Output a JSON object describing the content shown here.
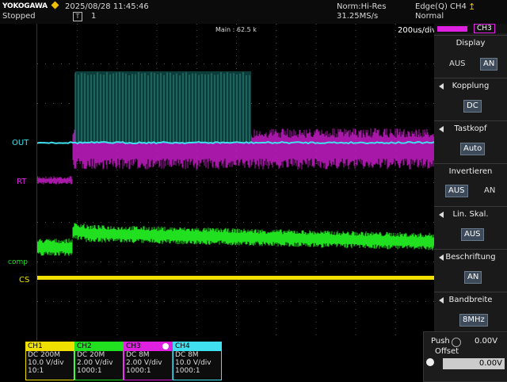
{
  "header": {
    "brand": "YOKOGAWA",
    "status": "Stopped",
    "datetime": "2025/08/28 11:45:46",
    "trigger_marker": "1",
    "acq_mode": "Norm:Hi-Res",
    "sample_rate": "31.25MS/s",
    "trigger_info": "Edge(Q) CH4",
    "trigger_mode": "Normal"
  },
  "screen": {
    "main_label": "Main : 62.5 k",
    "timebase": "200us/div",
    "labels": {
      "out": "OUT",
      "rt": "RT",
      "comp": "comp",
      "cs": "CS"
    }
  },
  "menu": {
    "channel_tab": "CH3",
    "display": {
      "title": "Display",
      "off": "AUS",
      "on": "AN"
    },
    "kopplung": {
      "title": "Kopplung",
      "value": "DC"
    },
    "tastkopf": {
      "title": "Tastkopf",
      "value": "Auto"
    },
    "invertieren": {
      "title": "Invertieren",
      "off": "AUS",
      "on": "AN"
    },
    "lin_skal": {
      "title": "Lin. Skal.",
      "value": "AUS"
    },
    "beschriftung": {
      "title": "Beschriftung",
      "value": "AN"
    },
    "bandbreite": {
      "title": "Bandbreite",
      "value": "8MHz"
    }
  },
  "push": {
    "label": "Push",
    "offset_label": "Offset",
    "value": "0.00V",
    "field_value": "0.00V"
  },
  "channels": [
    {
      "name": "CH1",
      "coupling": "DC 200M",
      "vdiv": "10.0 V/div",
      "ratio": "10:1",
      "color": "#f0e000"
    },
    {
      "name": "CH2",
      "coupling": "DC 20M",
      "vdiv": "2.00 V/div",
      "ratio": "1000:1",
      "color": "#20e020"
    },
    {
      "name": "CH3",
      "coupling": "DC 8M",
      "vdiv": "2.00 V/div",
      "ratio": "1000:1",
      "color": "#e020e0"
    },
    {
      "name": "CH4",
      "coupling": "DC 8M",
      "vdiv": "10.0 V/div",
      "ratio": "1000:1",
      "color": "#40e0f0"
    }
  ],
  "colors": {
    "ch1": "#f0e000",
    "ch2": "#20e020",
    "ch3": "#e020e0",
    "ch4": "#40e0f0",
    "accent_warning": "#f0c000"
  }
}
